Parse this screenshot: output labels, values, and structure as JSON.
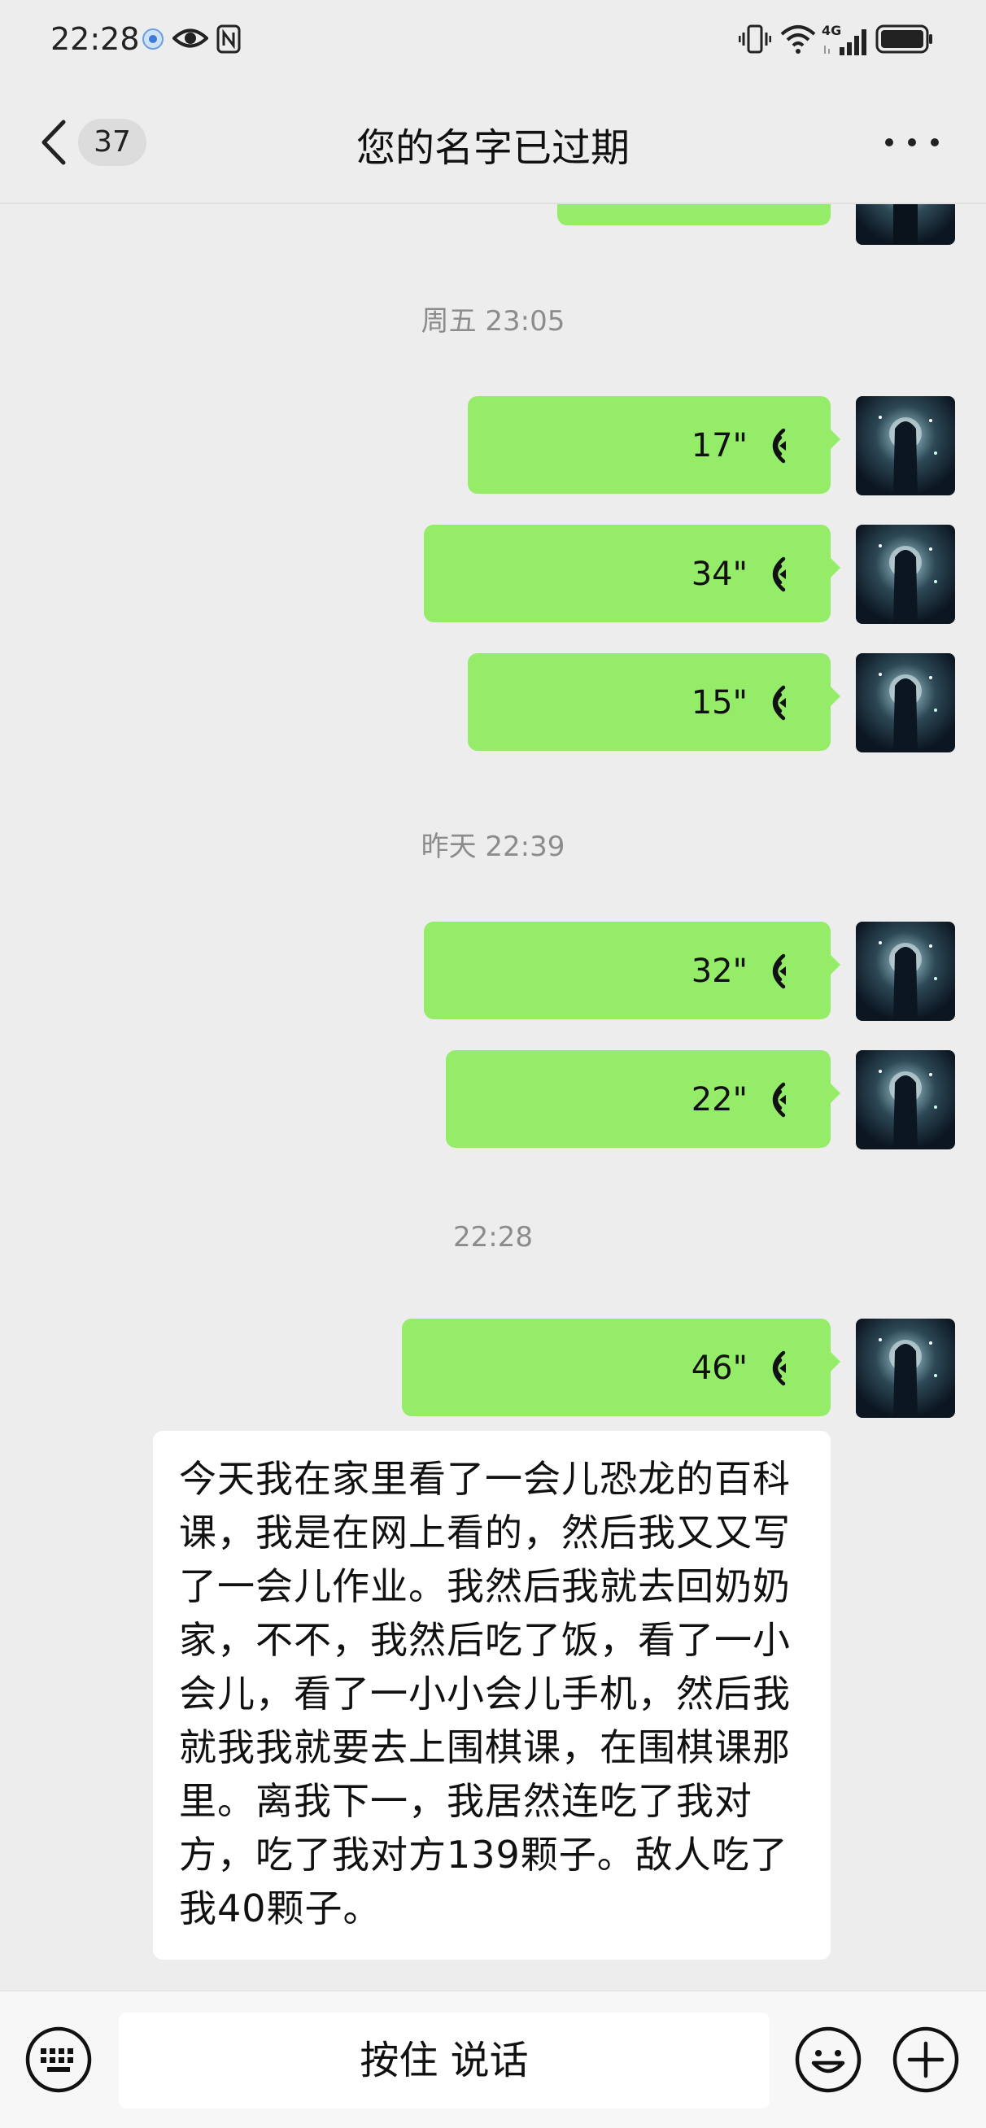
{
  "status_bar": {
    "time": "22:28",
    "icons_left": [
      "app-notification-icon",
      "eye-icon",
      "nfc-icon"
    ],
    "icons_right": [
      "vibrate-icon",
      "wifi-icon",
      "4g-signal-icon",
      "battery-icon"
    ],
    "network_label": "4G"
  },
  "nav": {
    "unread_count": "37",
    "title": "您的名字已过期"
  },
  "messages": [
    {
      "kind": "timestamp",
      "text": "周五 23:05"
    },
    {
      "kind": "voice",
      "sender": "self",
      "duration": "17\""
    },
    {
      "kind": "voice",
      "sender": "self",
      "duration": "34\""
    },
    {
      "kind": "voice",
      "sender": "self",
      "duration": "15\""
    },
    {
      "kind": "timestamp",
      "text": "昨天 22:39"
    },
    {
      "kind": "voice",
      "sender": "self",
      "duration": "32\""
    },
    {
      "kind": "voice",
      "sender": "self",
      "duration": "22\""
    },
    {
      "kind": "timestamp",
      "text": "22:28"
    },
    {
      "kind": "voice",
      "sender": "self",
      "duration": "46\""
    },
    {
      "kind": "transcription",
      "text": "今天我在家里看了一会儿恐龙的百科课，我是在网上看的，然后我又又写了一会儿作业。我然后我就去回奶奶家，不不，我然后吃了饭，看了一小会儿，看了一小小会儿手机，然后我就我我就要去上围棋课，在围棋课那里。离我下一，我居然连吃了我对方，吃了我对方139颗子。敌人吃了我40颗子。"
    }
  ],
  "input_bar": {
    "hold_to_talk_label": "按住 说话"
  },
  "colors": {
    "background": "#ededed",
    "self_bubble": "#95ec69",
    "text_bubble": "#ffffff",
    "timestamp": "#8c8c8c"
  }
}
